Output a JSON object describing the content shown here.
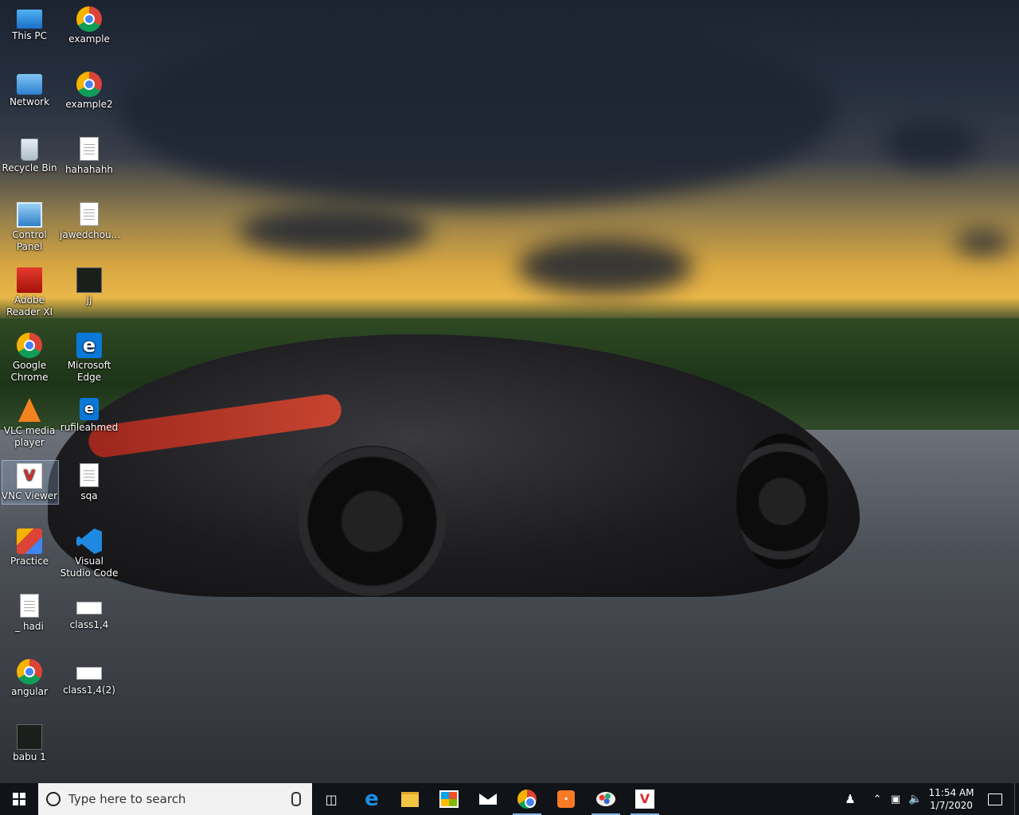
{
  "desktop_icons": [
    {
      "label": "This PC",
      "icon": "computer-icon"
    },
    {
      "label": "example",
      "icon": "chrome-icon"
    },
    {
      "label": "Network",
      "icon": "network-icon"
    },
    {
      "label": "example2",
      "icon": "chrome-icon"
    },
    {
      "label": "Recycle Bin",
      "icon": "recycle-bin-icon"
    },
    {
      "label": "hahahahh",
      "icon": "document-icon"
    },
    {
      "label": "Control Panel",
      "icon": "control-panel-icon"
    },
    {
      "label": "jawedchou...",
      "icon": "text-file-icon"
    },
    {
      "label": "Adobe Reader XI",
      "icon": "adobe-reader-icon"
    },
    {
      "label": "jj",
      "icon": "terminal-icon"
    },
    {
      "label": "Google Chrome",
      "icon": "chrome-icon"
    },
    {
      "label": "Microsoft Edge",
      "icon": "edge-icon"
    },
    {
      "label": "VLC media player",
      "icon": "vlc-icon"
    },
    {
      "label": "rufileahmed",
      "icon": "edge-shortcut-icon"
    },
    {
      "label": "VNC Viewer",
      "icon": "vnc-viewer-icon"
    },
    {
      "label": "sqa",
      "icon": "text-file-icon"
    },
    {
      "label": "Practice",
      "icon": "practice-icon"
    },
    {
      "label": "Visual Studio Code",
      "icon": "vscode-icon"
    },
    {
      "label": "_ hadi",
      "icon": "text-file-icon"
    },
    {
      "label": "class1,4",
      "icon": "blank-file-icon"
    },
    {
      "label": "angular",
      "icon": "chrome-icon"
    },
    {
      "label": "class1,4(2)",
      "icon": "blank-file-icon"
    },
    {
      "label": "babu 1",
      "icon": "terminal-icon"
    }
  ],
  "taskbar": {
    "search_placeholder": "Type here to search",
    "apps": [
      "task-view-icon",
      "edge-icon",
      "file-explorer-icon",
      "store-icon",
      "mail-icon",
      "chrome-icon",
      "xampp-icon",
      "paint-icon",
      "vnc-viewer-icon"
    ],
    "clock_time": "11:54 AM",
    "clock_date": "1/7/2020"
  }
}
